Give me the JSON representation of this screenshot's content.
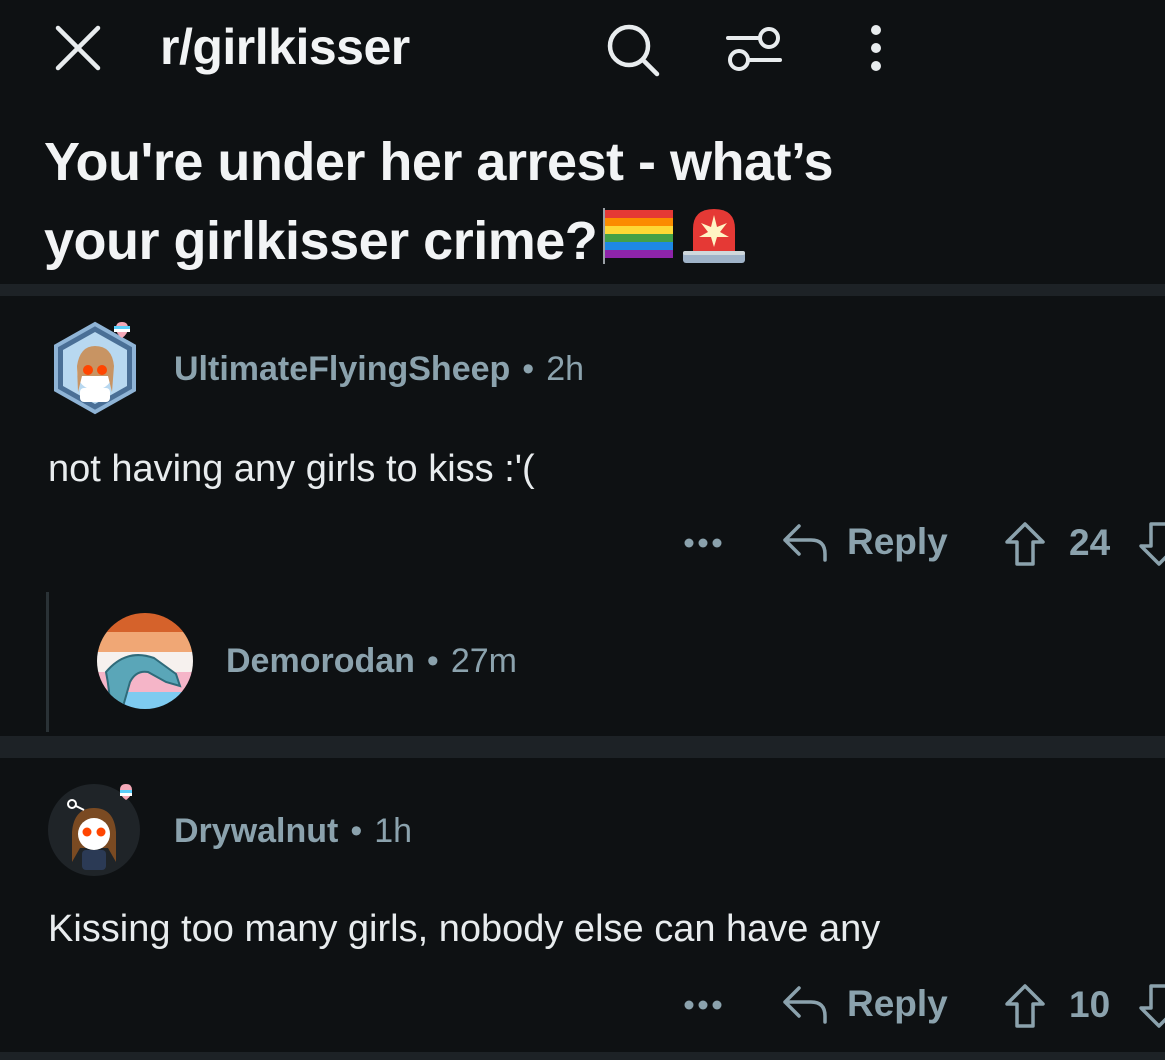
{
  "header": {
    "subreddit": "r/girlkisser",
    "icons": [
      "close-icon",
      "search-icon",
      "filter-icon",
      "more-vertical-icon"
    ]
  },
  "post": {
    "title_line1": "You're under her arrest - what’s",
    "title_line2": "your girlkisser crime?",
    "emojis": [
      "rainbow-flag-emoji",
      "police-light-emoji"
    ]
  },
  "comments": [
    {
      "username": "UltimateFlyingSheep",
      "time": "2h",
      "body": "not having any girls to kiss :'(",
      "reply_label": "Reply",
      "score": "24"
    },
    {
      "username": "Demorodan",
      "time": "27m",
      "collapsed": true
    },
    {
      "username": "Drywalnut",
      "time": "1h",
      "body": "Kissing too many girls, nobody else can have any",
      "reply_label": "Reply",
      "score": "10"
    }
  ],
  "colors": {
    "background": "#0e1113",
    "divider": "#1d2226",
    "meta_text": "#8ba2ad",
    "body_text": "#e8ecee"
  }
}
